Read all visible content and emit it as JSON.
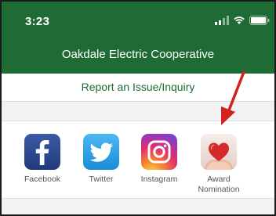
{
  "status_bar": {
    "time": "3:23"
  },
  "nav": {
    "title": "Oakdale Electric Cooperative"
  },
  "report": {
    "label": "Report an Issue/Inquiry"
  },
  "social": [
    {
      "label": "Facebook",
      "icon": "facebook-icon"
    },
    {
      "label": "Twitter",
      "icon": "twitter-icon"
    },
    {
      "label": "Instagram",
      "icon": "instagram-icon"
    },
    {
      "label": "Award Nomination",
      "icon": "heart-in-hands-icon"
    }
  ],
  "colors": {
    "brand_green": "#1f6b35",
    "arrow_red": "#d32020"
  }
}
